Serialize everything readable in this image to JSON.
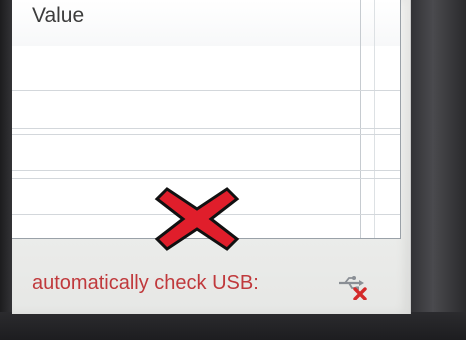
{
  "grid": {
    "column_header": "Value"
  },
  "status": {
    "usb_label": "automatically check USB:",
    "usb_icon": "usb-disconnected-icon",
    "label_color": "#c0393c"
  },
  "overlay": {
    "icon": "red-x-icon",
    "color": "#e01e2b"
  }
}
